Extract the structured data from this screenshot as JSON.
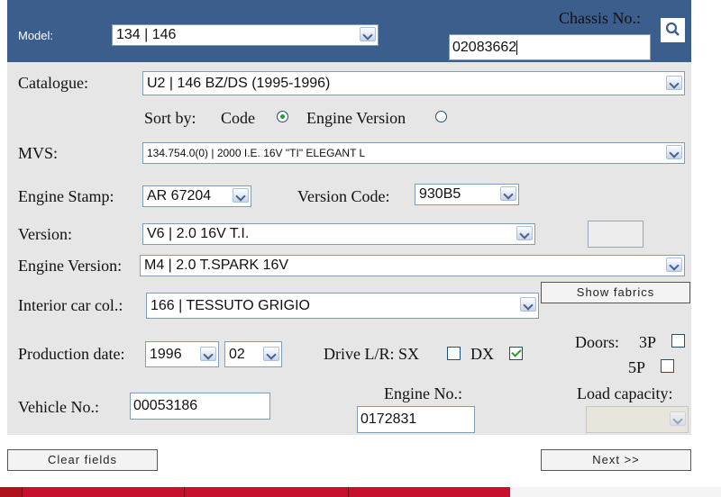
{
  "header": {
    "model_label": "Model:",
    "model_value": "134 | 146",
    "chassis_label": "Chassis No.:",
    "chassis_value": "02083662"
  },
  "catalogue": {
    "label": "Catalogue:",
    "value": "U2  |  146  BZ/DS  (1995-1996)"
  },
  "sort": {
    "label": "Sort by:",
    "code_label": "Code",
    "engine_label": "Engine Version",
    "selected": "Code"
  },
  "mvs": {
    "label": "MVS:",
    "value": "134.754.0(0) | 2000 I.E. 16V \"TI\" ELEGANT L"
  },
  "engine_stamp": {
    "label": "Engine Stamp:",
    "value": "AR 67204"
  },
  "version_code": {
    "label": "Version Code:",
    "value": "930B5"
  },
  "version": {
    "label": "Version:",
    "value": "V6 | 2.0 16V T.I."
  },
  "engine_version": {
    "label": "Engine Version:",
    "value": "M4 | 2.0 T.SPARK 16V"
  },
  "interior": {
    "label": "Interior car col.:",
    "value": "166 | TESSUTO GRIGIO",
    "fabrics_button": "Show fabrics"
  },
  "production": {
    "label": "Production date:",
    "year": "1996",
    "month": "02"
  },
  "drive": {
    "label": "Drive L/R: SX",
    "dx_label": "DX",
    "sx_checked": false,
    "dx_checked": true
  },
  "doors": {
    "label": "Doors:",
    "opt1": "3P",
    "opt2": "5P"
  },
  "vehicle": {
    "label": "Vehicle No.:",
    "value": "00053186"
  },
  "engine_no": {
    "label": "Engine No.:",
    "value": "0172831"
  },
  "load": {
    "label": "Load capacity:"
  },
  "buttons": {
    "clear": "Clear fields",
    "next": "Next >>"
  },
  "colors": {
    "header": "#3c5e8c",
    "panel": "#e6e6e6",
    "check": "#21a121",
    "taskbar_red": "#c8102e"
  }
}
